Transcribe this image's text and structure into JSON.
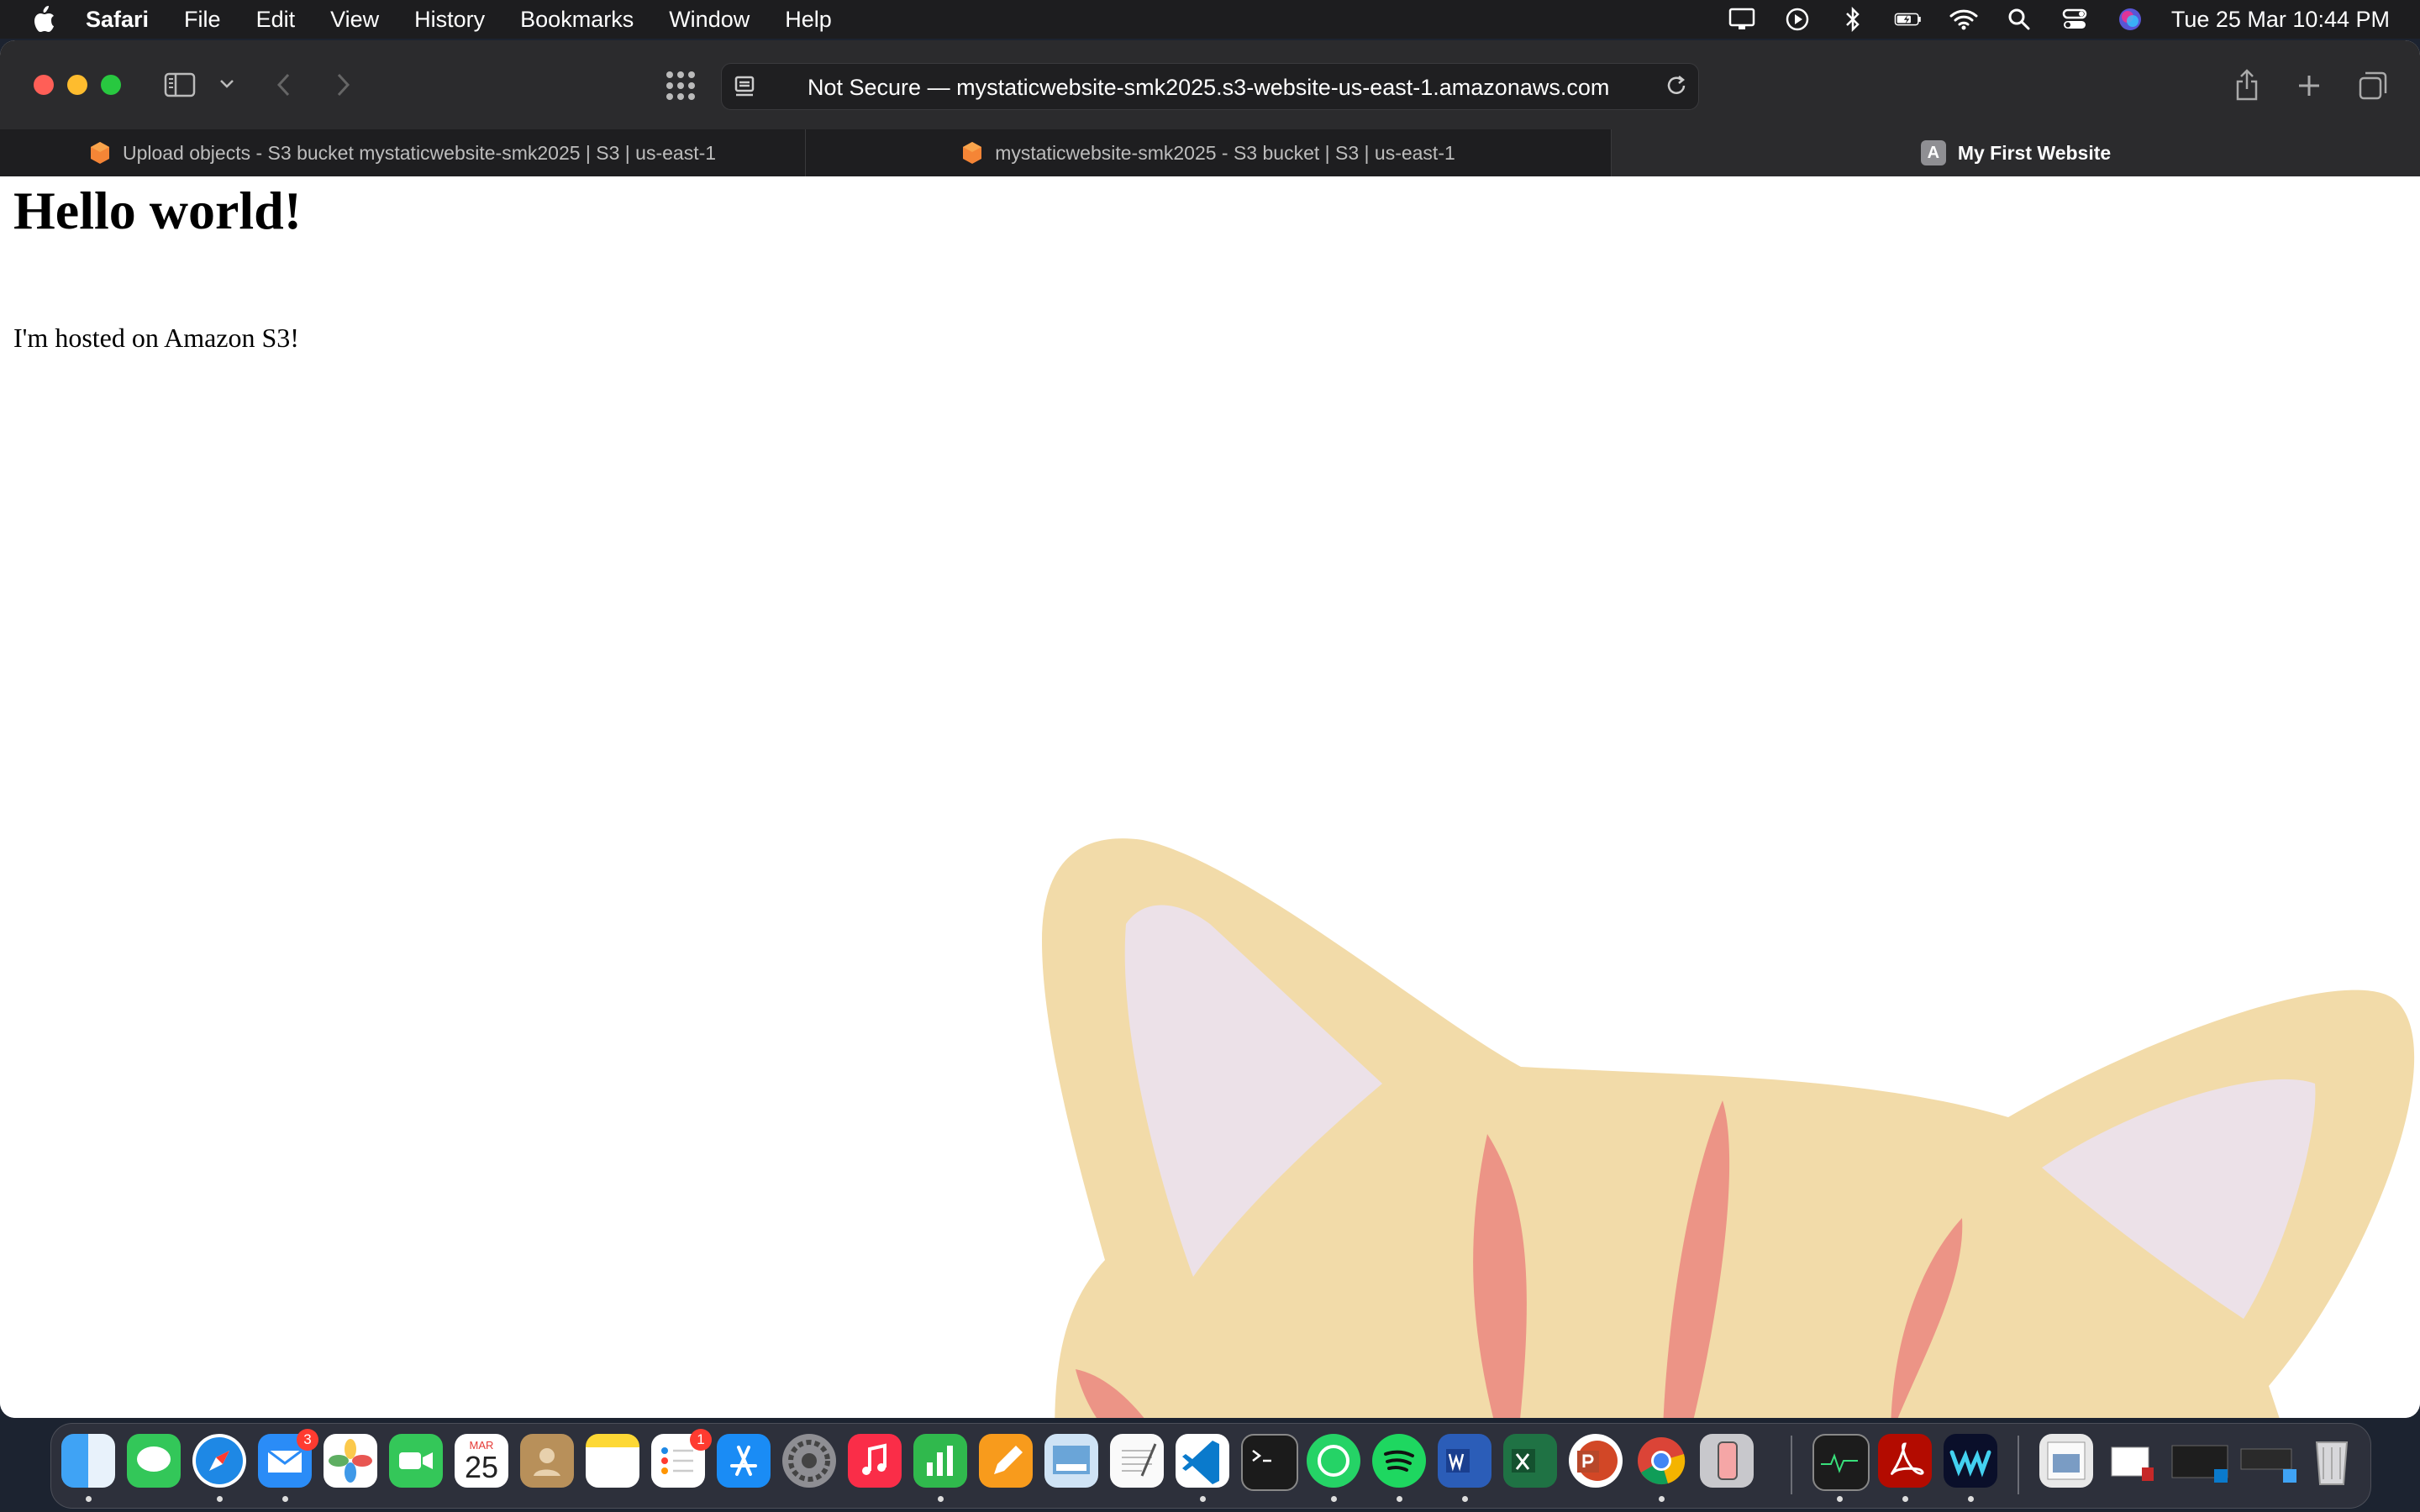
{
  "menubar": {
    "app_name": "Safari",
    "items": [
      "File",
      "Edit",
      "View",
      "History",
      "Bookmarks",
      "Window",
      "Help"
    ],
    "clock": "Tue 25 Mar  10:44 PM"
  },
  "browser": {
    "address": {
      "prefix": "Not Secure — ",
      "host": "mystaticwebsite-smk2025.s3-website-us-east-1.amazonaws.com"
    },
    "tabs": [
      {
        "label": "Upload objects - S3 bucket mystaticwebsite-smk2025 | S3 | us-east-1",
        "favicon": "aws-s3-icon"
      },
      {
        "label": "mystaticwebsite-smk2025 - S3 bucket | S3 | us-east-1",
        "favicon": "aws-s3-icon"
      },
      {
        "label": "My First Website",
        "favicon_letter": "A"
      }
    ]
  },
  "page": {
    "heading": "Hello world!",
    "paragraph": "I'm hosted on Amazon S3!"
  },
  "dock": {
    "calendar_month": "MAR",
    "calendar_day": "25",
    "mail_badge": "3",
    "reminders_badge": "1"
  }
}
